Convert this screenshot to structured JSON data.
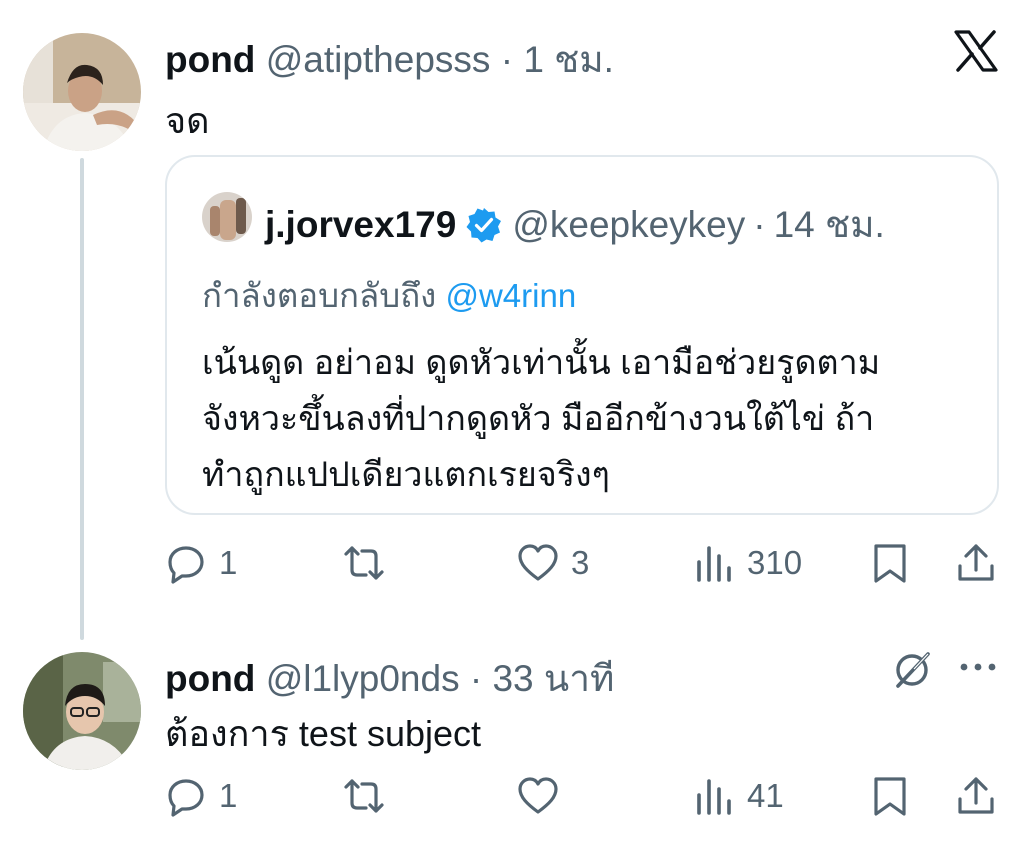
{
  "post1": {
    "name": "pond",
    "handle": "@atipthepsss",
    "separator": "·",
    "time": "1 ชม.",
    "text": "จด",
    "actions": {
      "reply_count": "1",
      "retweet_count": "",
      "like_count": "3",
      "views_count": "310"
    }
  },
  "quote": {
    "name": "j.jorvex179",
    "handle": "@keepkeykey",
    "separator": "·",
    "time": "14 ชม.",
    "reply_prefix": "กำลังตอบกลับถึง",
    "reply_mention": "@w4rinn",
    "text_lines": [
      "เน้นดูด อย่าอม ดูดหัวเท่านั้น เอามือช่วยรูดตาม",
      "จังหวะขึ้นลงที่ปากดูดหัว มืออีกข้างวนใต้ไข่ ถ้า",
      "ทำถูกแปปเดียวแตกเรยจริงๆ"
    ]
  },
  "post2": {
    "name": "pond",
    "handle": "@l1lyp0nds",
    "separator": "·",
    "time": "33 นาที",
    "text": "ต้องการ test subject",
    "actions": {
      "reply_count": "1",
      "retweet_count": "",
      "like_count": "",
      "views_count": "41"
    }
  },
  "colors": {
    "text": "#0f1419",
    "muted": "#536471",
    "accent": "#1d9bf0",
    "border": "#e1e8ed",
    "thread": "#cfd9de"
  },
  "icons": [
    "x-logo-icon",
    "reply-icon",
    "retweet-icon",
    "like-icon",
    "views-icon",
    "bookmark-icon",
    "share-icon",
    "verified-badge-icon",
    "grok-icon",
    "more-icon"
  ]
}
